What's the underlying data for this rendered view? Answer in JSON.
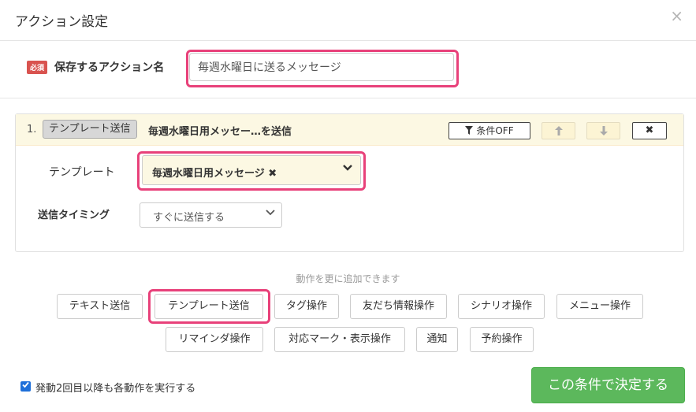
{
  "header": {
    "title": "アクション設定",
    "close_glyph": "×"
  },
  "name_row": {
    "required_badge": "必須",
    "label": "保存するアクション名",
    "value": "毎週水曜日に送るメッセージ"
  },
  "action": {
    "step_number": "1.",
    "type_tag": "テンプレート送信",
    "title": "毎週水曜日用メッセー…を送信",
    "condition_button": "条件OFF",
    "up_glyph": "🡅",
    "down_glyph": "🡇",
    "delete_glyph": "✖",
    "template_label": "テンプレート",
    "template_value": "毎週水曜日用メッセージ ✖",
    "timing_label": "送信タイミング",
    "timing_value": "すぐに送信する"
  },
  "add_section": {
    "hint": "動作を更に追加できます",
    "buttons": [
      "テキスト送信",
      "テンプレート送信",
      "タグ操作",
      "友だち情報操作",
      "シナリオ操作",
      "メニュー操作",
      "リマインダ操作",
      "対応マーク・表示操作",
      "通知",
      "予約操作"
    ]
  },
  "footer": {
    "repeat_checked": true,
    "repeat_label": "発動2回目以降も各動作を実行する",
    "submit_label": "この条件で決定する"
  },
  "colors": {
    "highlight": "#e8417a",
    "submit_green": "#5cb85c",
    "required_red": "#d9534f",
    "action_header_yellow": "#fcf8e3"
  },
  "icons": {
    "filter": "filter-icon",
    "arrow_up": "arrow-up-icon",
    "arrow_down": "arrow-down-icon",
    "delete": "close-icon",
    "chevron": "chevron-down-icon",
    "checkbox": "check-icon"
  }
}
